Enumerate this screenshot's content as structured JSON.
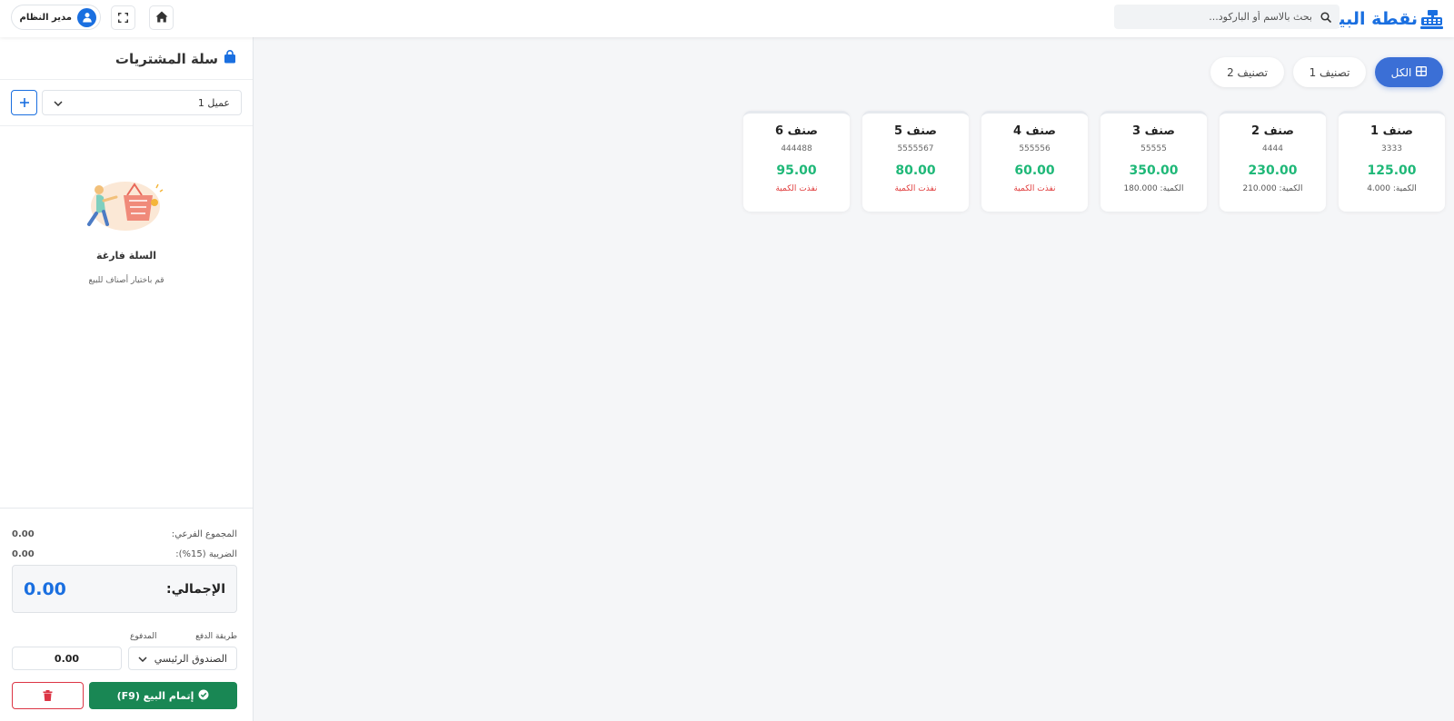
{
  "header": {
    "brand": "نقطة البيع",
    "search_placeholder": "بحث بالاسم أو الباركود...",
    "user_name": "مدير النظام"
  },
  "categories": {
    "all": "الكل",
    "cat1": "تصنيف 1",
    "cat2": "تصنيف 2"
  },
  "products": [
    {
      "name": "صنف 1",
      "code": "3333",
      "price": "125.00",
      "stock": "الكمية: 4.000",
      "out": false
    },
    {
      "name": "صنف 2",
      "code": "4444",
      "price": "230.00",
      "stock": "الكمية: 210.000",
      "out": false
    },
    {
      "name": "صنف 3",
      "code": "55555",
      "price": "350.00",
      "stock": "الكمية: 180.000",
      "out": false
    },
    {
      "name": "صنف 4",
      "code": "555556",
      "price": "60.00",
      "stock": "نفذت الكمية",
      "out": true
    },
    {
      "name": "صنف 5",
      "code": "5555567",
      "price": "80.00",
      "stock": "نفذت الكمية",
      "out": true
    },
    {
      "name": "صنف 6",
      "code": "444488",
      "price": "95.00",
      "stock": "نفذت الكمية",
      "out": true
    }
  ],
  "cart": {
    "title": "سلة المشتريات",
    "customer": "عميل 1",
    "empty_title": "السلة فارغة",
    "empty_sub": "قم باختيار أصناف للبيع",
    "subtotal_label": "المجموع الفرعي:",
    "subtotal_value": "0.00",
    "tax_label": "الضريبة (15%):",
    "tax_value": "0.00",
    "total_label": "الإجمالي:",
    "total_value": "0.00",
    "pay_method_label": "طريقة الدفع",
    "pay_method_value": "الصندوق الرئيسي",
    "paid_label": "المدفوع",
    "paid_value": "0.00",
    "complete_label": "إتمام البيع (F9)"
  },
  "colors": {
    "primary": "#1a6fe0",
    "active_tab": "#3b6fd6",
    "price": "#1fb878",
    "out_of_stock": "#e03b3b",
    "complete_button": "#198754",
    "danger": "#dc3545"
  }
}
